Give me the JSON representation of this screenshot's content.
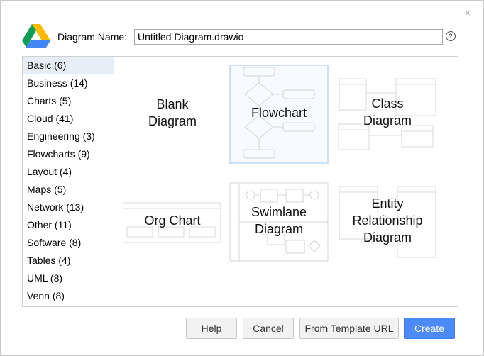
{
  "dialog": {
    "name_label": "Diagram Name:",
    "name_value": "Untitled Diagram.drawio",
    "close_glyph": "×",
    "help_glyph": "?"
  },
  "categories": [
    {
      "label": "Basic (6)",
      "selected": true
    },
    {
      "label": "Business (14)"
    },
    {
      "label": "Charts (5)"
    },
    {
      "label": "Cloud (41)"
    },
    {
      "label": "Engineering (3)"
    },
    {
      "label": "Flowcharts (9)"
    },
    {
      "label": "Layout (4)"
    },
    {
      "label": "Maps (5)"
    },
    {
      "label": "Network (13)"
    },
    {
      "label": "Other (11)"
    },
    {
      "label": "Software (8)"
    },
    {
      "label": "Tables (4)"
    },
    {
      "label": "UML (8)"
    },
    {
      "label": "Venn (8)"
    }
  ],
  "templates": [
    {
      "label": "Blank\nDiagram"
    },
    {
      "label": "Flowchart",
      "selected": true
    },
    {
      "label": "Class\nDiagram"
    },
    {
      "label": "Org Chart"
    },
    {
      "label": "Swimlane\nDiagram"
    },
    {
      "label": "Entity\nRelationship\nDiagram"
    }
  ],
  "buttons": {
    "help": "Help",
    "cancel": "Cancel",
    "template_url": "From Template URL",
    "create": "Create"
  },
  "colors": {
    "accent": "#4c8bf5",
    "selected_row": "#e6eef8"
  }
}
